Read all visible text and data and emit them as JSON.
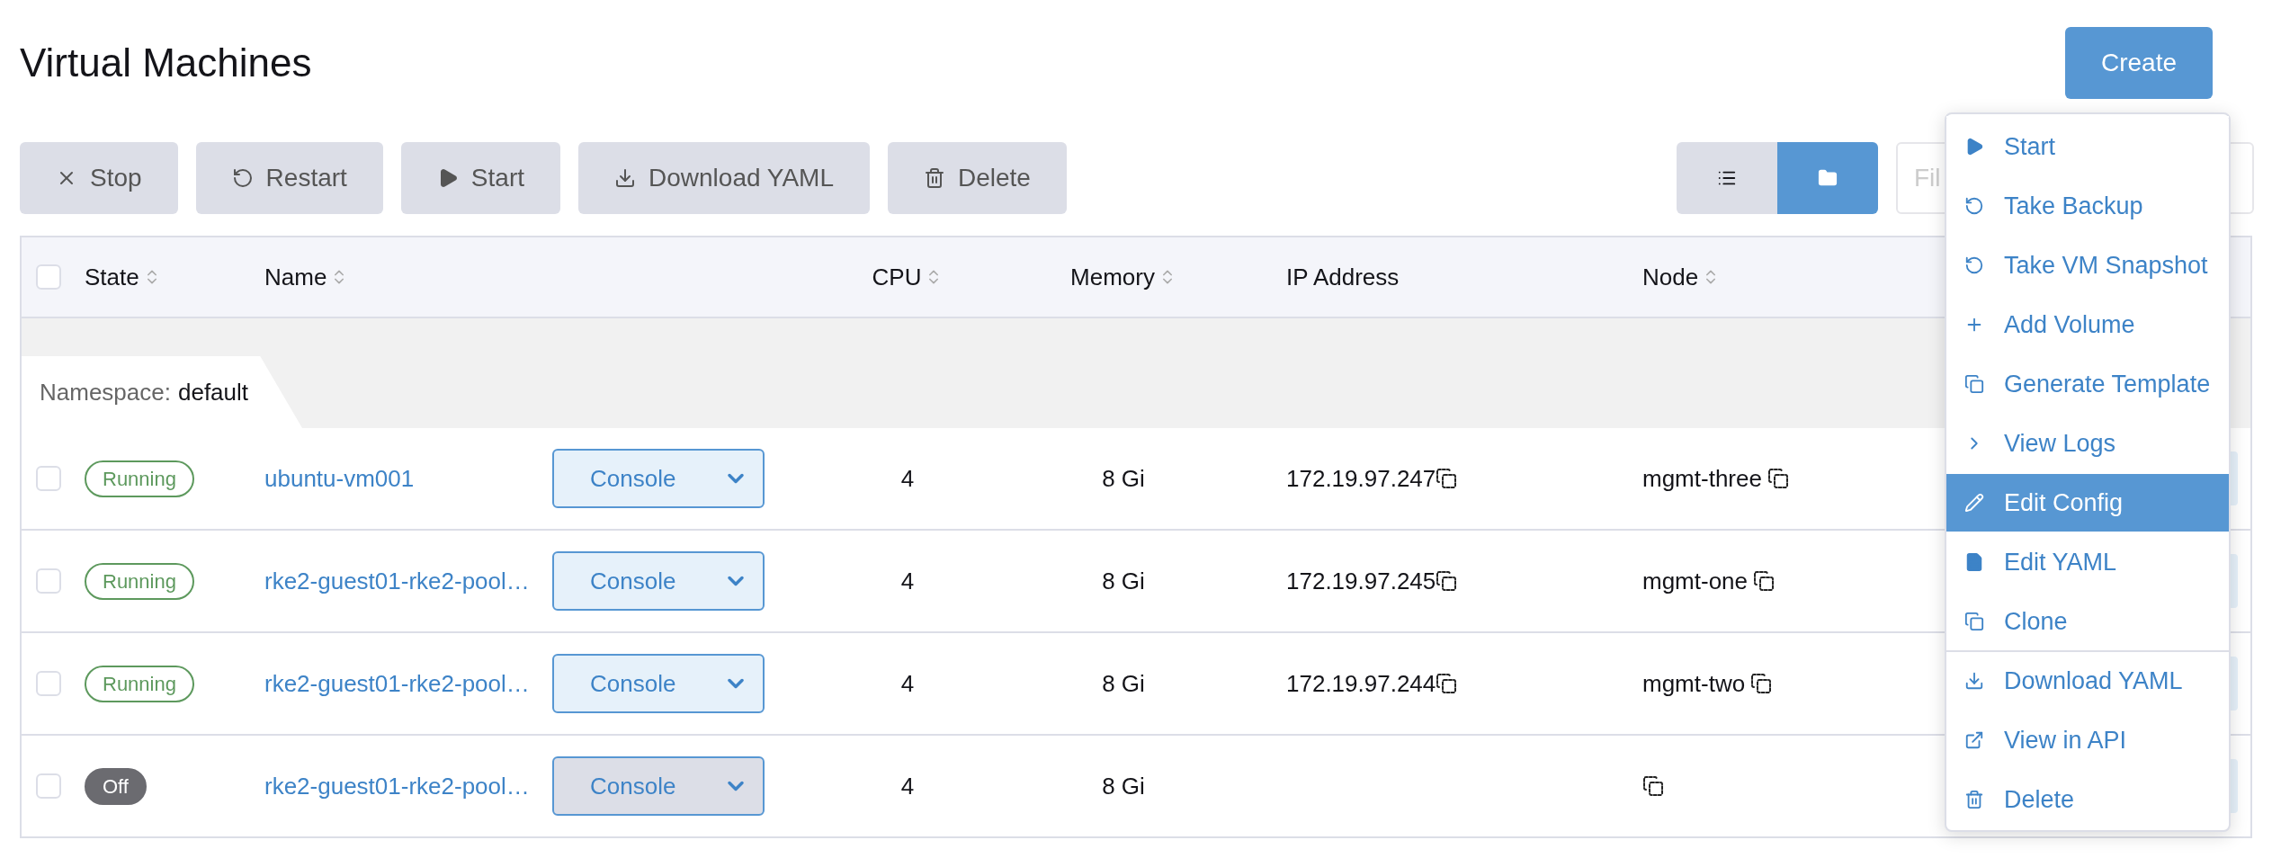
{
  "page": {
    "title": "Virtual Machines",
    "create_button": "Create"
  },
  "bulk_actions": [
    {
      "label": "Stop"
    },
    {
      "label": "Restart"
    },
    {
      "label": "Start"
    },
    {
      "label": "Download YAML"
    },
    {
      "label": "Delete"
    }
  ],
  "view_toggle": [
    {
      "selected": false
    },
    {
      "selected": true
    }
  ],
  "filter": {
    "placeholder": "Fil"
  },
  "table": {
    "select_all_checked": false,
    "columns": [
      {
        "label": "State",
        "sortable": true
      },
      {
        "label": "Name",
        "sortable": true
      },
      {
        "label": "CPU",
        "sortable": true
      },
      {
        "label": "Memory",
        "sortable": true
      },
      {
        "label": "IP Address",
        "sortable": false
      },
      {
        "label": "Node",
        "sortable": true
      }
    ],
    "group": {
      "label": "Namespace:",
      "value": "default"
    },
    "rows": [
      {
        "checked": false,
        "state": "Running",
        "kind": "running",
        "name": "ubuntu-vm001",
        "console": "Console",
        "cpu": "4",
        "memory": "8 Gi",
        "ip": "172.19.97.247",
        "node": "mgmt-three"
      },
      {
        "checked": false,
        "state": "Running",
        "kind": "running",
        "name": "rke2-guest01-rke2-pool…",
        "console": "Console",
        "cpu": "4",
        "memory": "8 Gi",
        "ip": "172.19.97.245",
        "node": "mgmt-one"
      },
      {
        "checked": false,
        "state": "Running",
        "kind": "running",
        "name": "rke2-guest01-rke2-pool…",
        "console": "Console",
        "cpu": "4",
        "memory": "8 Gi",
        "ip": "172.19.97.244",
        "node": "mgmt-two"
      },
      {
        "checked": false,
        "state": "Off",
        "kind": "off",
        "name": "rke2-guest01-rke2-pool…",
        "console": "Console",
        "cpu": "4",
        "memory": "8 Gi",
        "ip": "",
        "node": ""
      }
    ]
  },
  "action_menu": [
    {
      "label": "Start",
      "selected": false,
      "divider_before": false
    },
    {
      "label": "Take Backup",
      "selected": false,
      "divider_before": false
    },
    {
      "label": "Take VM Snapshot",
      "selected": false,
      "divider_before": false
    },
    {
      "label": "Add Volume",
      "selected": false,
      "divider_before": false
    },
    {
      "label": "Generate Template",
      "selected": false,
      "divider_before": false
    },
    {
      "label": "View Logs",
      "selected": false,
      "divider_before": false
    },
    {
      "label": "Edit Config",
      "selected": true,
      "divider_before": false
    },
    {
      "label": "Edit YAML",
      "selected": false,
      "divider_before": false
    },
    {
      "label": "Clone",
      "selected": false,
      "divider_before": false
    },
    {
      "label": "Download YAML",
      "selected": false,
      "divider_before": true
    },
    {
      "label": "View in API",
      "selected": false,
      "divider_before": false
    },
    {
      "label": "Delete",
      "selected": false,
      "divider_before": false
    }
  ]
}
